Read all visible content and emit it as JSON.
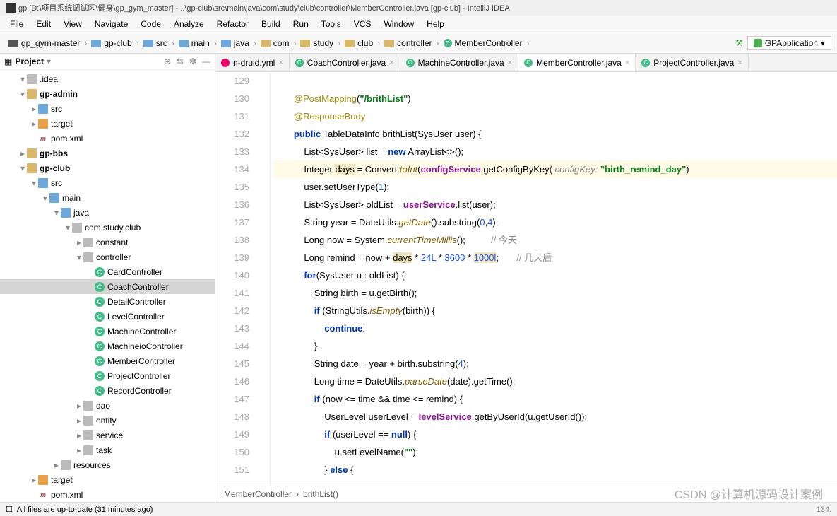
{
  "title": "gp [D:\\项目系统调试区\\健身\\gp_gym_master] - ..\\gp-club\\src\\main\\java\\com\\study\\club\\controller\\MemberController.java [gp-club] - IntelliJ IDEA",
  "menu": [
    "File",
    "Edit",
    "View",
    "Navigate",
    "Code",
    "Analyze",
    "Refactor",
    "Build",
    "Run",
    "Tools",
    "VCS",
    "Window",
    "Help"
  ],
  "breadcrumbs": [
    "gp_gym-master",
    "gp-club",
    "src",
    "main",
    "java",
    "com",
    "study",
    "club",
    "controller",
    "MemberController"
  ],
  "runConfig": "GPApplication",
  "sidebar": {
    "title": "Project",
    "nodes": [
      {
        "depth": 1,
        "arr": "▾",
        "ico": "folder gray",
        "label": ".idea"
      },
      {
        "depth": 1,
        "arr": "▾",
        "ico": "folder",
        "label": "gp-admin",
        "bold": true
      },
      {
        "depth": 2,
        "arr": "▸",
        "ico": "folder blue",
        "label": "src"
      },
      {
        "depth": 2,
        "arr": "▸",
        "ico": "folder orange",
        "label": "target"
      },
      {
        "depth": 2,
        "arr": "",
        "ico": "maven",
        "label": "pom.xml",
        "iconText": "m"
      },
      {
        "depth": 1,
        "arr": "▸",
        "ico": "folder",
        "label": "gp-bbs",
        "bold": true
      },
      {
        "depth": 1,
        "arr": "▾",
        "ico": "folder",
        "label": "gp-club",
        "bold": true
      },
      {
        "depth": 2,
        "arr": "▾",
        "ico": "folder blue",
        "label": "src"
      },
      {
        "depth": 3,
        "arr": "▾",
        "ico": "folder blue",
        "label": "main"
      },
      {
        "depth": 4,
        "arr": "▾",
        "ico": "folder blue",
        "label": "java"
      },
      {
        "depth": 5,
        "arr": "▾",
        "ico": "folder gray",
        "label": "com.study.club"
      },
      {
        "depth": 6,
        "arr": "▸",
        "ico": "folder gray",
        "label": "constant"
      },
      {
        "depth": 6,
        "arr": "▾",
        "ico": "folder gray",
        "label": "controller"
      },
      {
        "depth": 7,
        "arr": "",
        "ico": "class",
        "label": "CardController",
        "iconText": "C"
      },
      {
        "depth": 7,
        "arr": "",
        "ico": "class",
        "label": "CoachController",
        "iconText": "C",
        "selected": true
      },
      {
        "depth": 7,
        "arr": "",
        "ico": "class",
        "label": "DetailController",
        "iconText": "C"
      },
      {
        "depth": 7,
        "arr": "",
        "ico": "class",
        "label": "LevelController",
        "iconText": "C"
      },
      {
        "depth": 7,
        "arr": "",
        "ico": "class",
        "label": "MachineController",
        "iconText": "C"
      },
      {
        "depth": 7,
        "arr": "",
        "ico": "class",
        "label": "MachineioController",
        "iconText": "C"
      },
      {
        "depth": 7,
        "arr": "",
        "ico": "class",
        "label": "MemberController",
        "iconText": "C"
      },
      {
        "depth": 7,
        "arr": "",
        "ico": "class",
        "label": "ProjectController",
        "iconText": "C"
      },
      {
        "depth": 7,
        "arr": "",
        "ico": "class",
        "label": "RecordController",
        "iconText": "C"
      },
      {
        "depth": 6,
        "arr": "▸",
        "ico": "folder gray",
        "label": "dao"
      },
      {
        "depth": 6,
        "arr": "▸",
        "ico": "folder gray",
        "label": "entity"
      },
      {
        "depth": 6,
        "arr": "▸",
        "ico": "folder gray",
        "label": "service"
      },
      {
        "depth": 6,
        "arr": "▸",
        "ico": "folder gray",
        "label": "task"
      },
      {
        "depth": 4,
        "arr": "▸",
        "ico": "folder gray",
        "label": "resources"
      },
      {
        "depth": 2,
        "arr": "▸",
        "ico": "folder orange",
        "label": "target"
      },
      {
        "depth": 2,
        "arr": "",
        "ico": "maven",
        "label": "pom.xml",
        "iconText": "m"
      }
    ]
  },
  "tabs": [
    {
      "label": "n-druid.yml",
      "type": "yml"
    },
    {
      "label": "CoachController.java",
      "type": "c"
    },
    {
      "label": "MachineController.java",
      "type": "c"
    },
    {
      "label": "MemberController.java",
      "type": "c",
      "active": true
    },
    {
      "label": "ProjectController.java",
      "type": "c"
    }
  ],
  "lineStart": 129,
  "highlightLine": 134,
  "code": [
    "",
    "        <span class='ann'>@PostMapping</span>(<span class='str'>\"/brithList\"</span>)",
    "        <span class='ann'>@ResponseBody</span>",
    "        <span class='kw'>public</span> TableDataInfo brithList(SysUser user) {",
    "            List&lt;SysUser&gt; list = <span class='kw'>new</span> ArrayList&lt;&gt;();",
    "            Integer <span class='warn'>days</span> = Convert.<span class='fn'>toInt</span>(<span class='fld2'>configService</span>.getConfigByKey( <span class='param'>configKey:</span> <span class='str'>\"birth_remind_day\"</span>)",
    "            user.setUserType(<span class='num'>1</span>);",
    "            List&lt;SysUser&gt; oldList = <span class='fld2'>userService</span>.list(user);",
    "            String year = DateUtils.<span class='fn'>getDate</span>().substring(<span class='num'>0</span>,<span class='num'>4</span>);",
    "            Long now = System.<span class='fn'>currentTimeMillis</span>();          <span class='cmt'>// 今天</span>",
    "            Long remind = now + <span class='warn'>days</span> * <span class='num'>24L</span> * <span class='num'>3600</span> * <span class='warn'><span class='num'>1000l</span></span>;       <span class='cmt'>// 几天后</span>",
    "            <span class='kw'>for</span>(SysUser u : oldList) {",
    "                String birth = u.getBirth();",
    "                <span class='kw'>if</span> (StringUtils.<span class='fn'>isEmpty</span>(birth)) {",
    "                    <span class='kw'>continue</span>;",
    "                }",
    "                String date = year + birth.substring(<span class='num'>4</span>);",
    "                Long time = DateUtils.<span class='fn'>parseDate</span>(date).getTime();",
    "                <span class='kw'>if</span> (now &lt;= time &amp;&amp; time &lt;= remind) {",
    "                    UserLevel userLevel = <span class='fld2'>levelService</span>.getByUserId(u.getUserId());",
    "                    <span class='kw'>if</span> (userLevel == <span class='kw'>null</span>) {",
    "                        u.setLevelName(<span class='str'>\"\"</span>);",
    "                    } <span class='kw'>else</span> {"
  ],
  "editorCrumbs": [
    "MemberController",
    "brithList()"
  ],
  "status": "All files are up-to-date (31 minutes ago)",
  "statusRight": "134:",
  "watermark": "CSDN @计算机源码设计案例"
}
